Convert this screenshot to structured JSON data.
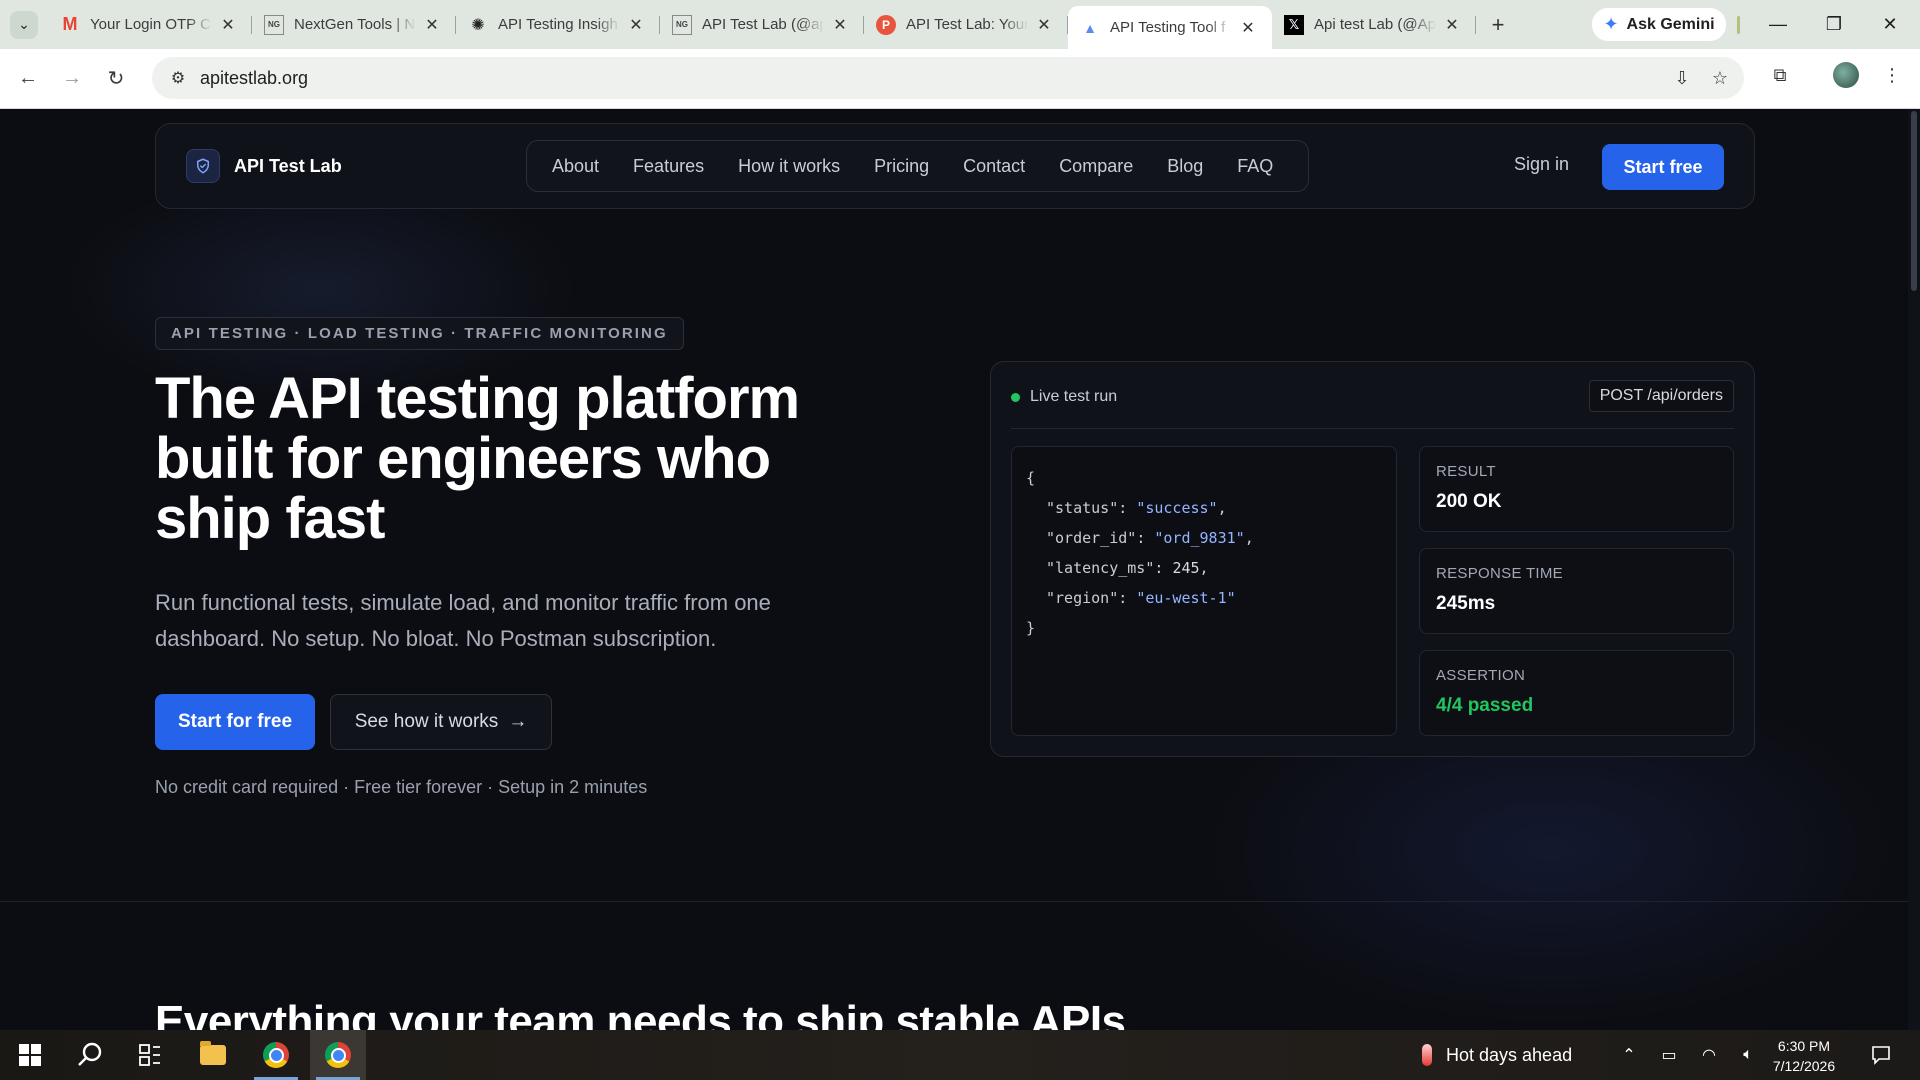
{
  "browser": {
    "tabs": [
      {
        "label": "Your Login OTP C",
        "favicon": "gmail-icon",
        "active": false
      },
      {
        "label": "NextGen Tools | N",
        "favicon": "nextgen-tools-icon",
        "active": false
      },
      {
        "label": "API Testing Insigh",
        "favicon": "openai-icon",
        "active": false
      },
      {
        "label": "API Test Lab (@ap",
        "favicon": "nextgen-tools-icon",
        "active": false
      },
      {
        "label": "API Test Lab: Your",
        "favicon": "producthunt-icon",
        "active": false
      },
      {
        "label": "API Testing Tool f",
        "favicon": "site-icon",
        "active": true
      },
      {
        "label": "Api test Lab (@Ap",
        "favicon": "x-icon",
        "active": false
      }
    ],
    "gemini_label": "Ask Gemini",
    "url": "apitestlab.org"
  },
  "site": {
    "brand": "API Test Lab",
    "nav": [
      "About",
      "Features",
      "How it works",
      "Pricing",
      "Contact",
      "Compare",
      "Blog",
      "FAQ"
    ],
    "sign_in": "Sign in",
    "start_free": "Start free"
  },
  "hero": {
    "tagline": "API TESTING · LOAD TESTING · TRAFFIC MONITORING",
    "title": "The API testing platform built for engineers who ship fast",
    "subtitle": "Run functional tests, simulate load, and monitor traffic from one dashboard. No setup. No bloat. No Postman subscription.",
    "cta_primary": "Start for free",
    "cta_secondary": "See how it works",
    "fineprint": "No credit card required · Free tier forever · Setup in 2 minutes"
  },
  "live_card": {
    "label": "Live test run",
    "endpoint": "POST /api/orders",
    "code": {
      "open": "{",
      "lines": [
        {
          "key": "\"status\"",
          "value": "\"success\"",
          "kind": "string",
          "comma": ","
        },
        {
          "key": "\"order_id\"",
          "value": "\"ord_9831\"",
          "kind": "string",
          "comma": ","
        },
        {
          "key": "\"latency_ms\"",
          "value": "245",
          "kind": "number",
          "comma": ","
        },
        {
          "key": "\"region\"",
          "value": "\"eu-west-1\"",
          "kind": "string",
          "comma": ""
        }
      ],
      "close": "}"
    },
    "stats": [
      {
        "label": "RESULT",
        "value": "200 OK"
      },
      {
        "label": "RESPONSE TIME",
        "value": "245ms"
      },
      {
        "label": "ASSERTION",
        "value": "4/4 passed"
      }
    ]
  },
  "next_section_title": "Everything your team needs to ship stable APIs",
  "taskbar": {
    "weather": "Hot days ahead",
    "time": "6:30 PM",
    "date": "7/12/2026"
  }
}
